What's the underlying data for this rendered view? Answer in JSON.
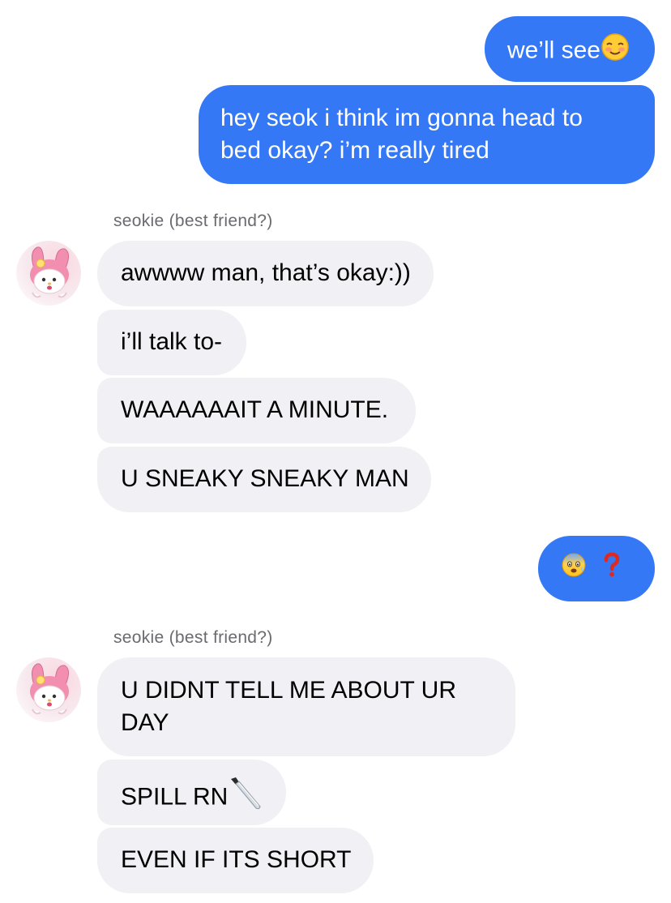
{
  "conversation": {
    "contact_label": "seokie (best friend?)",
    "messages": [
      {
        "sender": "me",
        "text": "we’ll see",
        "emoji": "smiling-face-with-blush-icon"
      },
      {
        "sender": "me",
        "lines": [
          "hey seok i think im gonna head to",
          "bed okay? i’m really tired"
        ]
      },
      {
        "sender": "them",
        "text": "awwww man, that’s okay:))"
      },
      {
        "sender": "them",
        "text": "i’ll talk to-"
      },
      {
        "sender": "them",
        "text": "WAAAAAAIT A MINUTE."
      },
      {
        "sender": "them",
        "text": "U SNEAKY SNEAKY MAN"
      },
      {
        "sender": "me",
        "emoji": [
          "anxious-face-icon",
          "red-question-mark-icon"
        ]
      },
      {
        "sender": "them",
        "lines": [
          "U DIDNT TELL ME ABOUT UR",
          "DAY"
        ]
      },
      {
        "sender": "them",
        "text": "SPILL RN",
        "emoji": "kitchen-knife-icon"
      },
      {
        "sender": "them",
        "text": "EVEN IF ITS SHORT"
      }
    ]
  },
  "colors": {
    "outgoing_bubble": "#3478f6",
    "incoming_bubble": "#f0f0f5",
    "sender_label": "#6a6a6f",
    "background": "#ffffff"
  }
}
